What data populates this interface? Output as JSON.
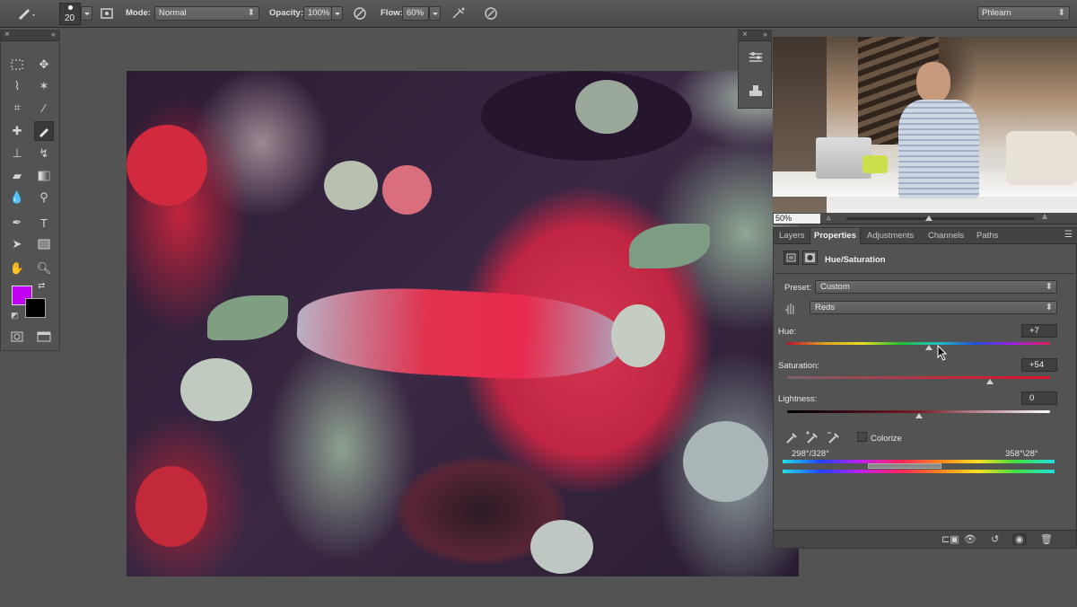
{
  "options_bar": {
    "brush_size": "20",
    "mode_label": "Mode:",
    "mode_value": "Normal",
    "opacity_label": "Opacity:",
    "opacity_value": "100%",
    "flow_label": "Flow:",
    "flow_value": "60%",
    "workspace": "Phlearn"
  },
  "colors": {
    "foreground": "#c100f3",
    "background": "#000000",
    "accent": "#a81d2f"
  },
  "video": {
    "zoom": "50%"
  },
  "properties": {
    "tabs": [
      "Layers",
      "Properties",
      "Adjustments",
      "Channels",
      "Paths"
    ],
    "active_tab": "Properties",
    "title": "Hue/Saturation",
    "preset_label": "Preset:",
    "preset_value": "Custom",
    "channel_value": "Reds",
    "hue_label": "Hue:",
    "hue_value": "+7",
    "hue_level": 0.54,
    "saturation_label": "Saturation:",
    "saturation_value": "+54",
    "saturation_level": 0.77,
    "lightness_label": "Lightness:",
    "lightness_value": "0",
    "lightness_level": 0.5,
    "colorize_label": "Colorize",
    "range_left": "298°/328°",
    "range_right": "358°\\28°"
  }
}
